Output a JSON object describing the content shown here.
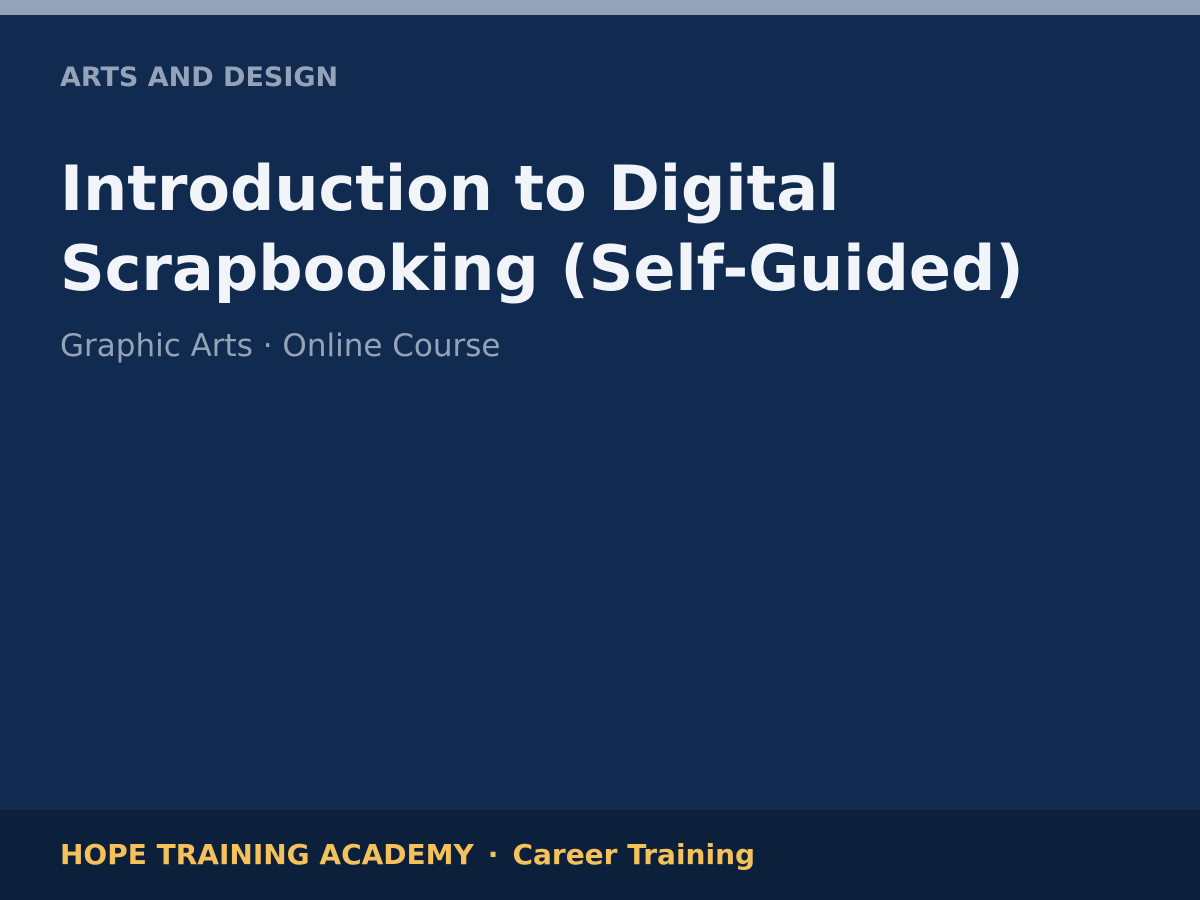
{
  "header": {
    "category": "ARTS AND DESIGN"
  },
  "course": {
    "title_lines": [
      "Introduction to Digital",
      "Scrapbooking (Self-Guided)"
    ],
    "subtitle": "Graphic Arts · Online Course"
  },
  "footer": {
    "organization": "HOPE TRAINING ACADEMY",
    "separator": "·",
    "program": "Career Training"
  },
  "colors": {
    "background": "#112a4f",
    "top_bar": "#94a3b8",
    "footer_background": "#0c1f3b",
    "accent": "#f4c15a",
    "title": "#f1f5f9",
    "muted": "#94a3b8"
  }
}
